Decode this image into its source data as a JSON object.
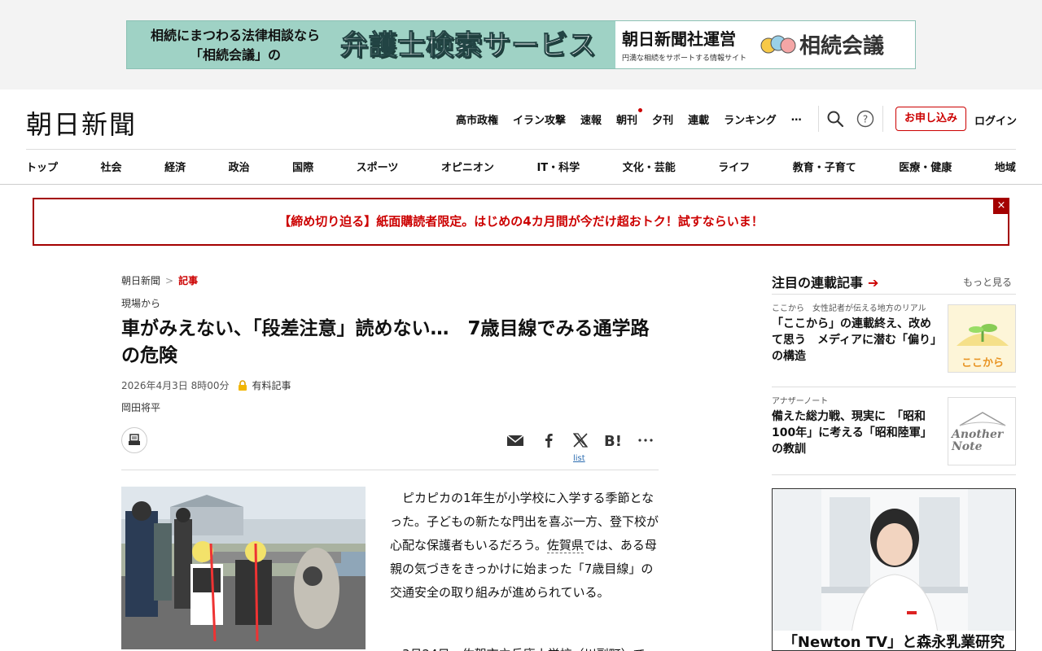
{
  "ad": {
    "left_line1": "相続にまつわる法律相談なら",
    "left_line2": "「相続会議」の",
    "big": "弁護士検索サービス",
    "operator": "朝日新聞社運営",
    "operator_sub": "円満な相続をサポートする情報サイト",
    "brand": "相続会議"
  },
  "header": {
    "logo": "朝日新聞",
    "topnav": [
      "高市政権",
      "イラン攻撃",
      "速報",
      "朝刊",
      "夕刊",
      "連載",
      "ランキング",
      "…"
    ],
    "subscribe": "お申し込み",
    "login": "ログイン"
  },
  "catnav": [
    "トップ",
    "社会",
    "経済",
    "政治",
    "国際",
    "スポーツ",
    "オピニオン",
    "IT・科学",
    "文化・芸能",
    "ライフ",
    "教育・子育て",
    "医療・健康",
    "地域"
  ],
  "promo": {
    "text": "【締め切り迫る】紙面購読者限定。はじめの4カ月間が今だけ超おトク！試すならいま！",
    "close": "×"
  },
  "article": {
    "breadcrumb": [
      "朝日新聞",
      "記事"
    ],
    "series": "現場から",
    "title": "車がみえない、「段差注意」読めない…　7歳目線でみる通学路の危険",
    "date": "2026年4月3日 8時00分",
    "paid": "有料記事",
    "author": "岡田将平",
    "list_link": "list",
    "body_pre": "ピカピカの1年生が小学校に入学する季節となった。子どもの新たな門出を喜ぶ一方、登下校が心配な保護者もいるだろう。",
    "body_link": "佐賀県",
    "body_post": "では、ある母親の気づきをきっかけに始まった「7歳目線」の交通安全の取り組みが進められている。",
    "body2": "3月24日、佐賀市立兵庫小学校（川副町）で"
  },
  "sidebar": {
    "heading": "注目の連載記事",
    "more": "もっと見る",
    "items": [
      {
        "kicker": "ここから　女性記者が伝える地方のリアル",
        "title": "「ここから」の連載終え、改めて思う　メディアに潜む「偏り」の構造",
        "thumb_label": "ここから"
      },
      {
        "kicker": "アナザーノート",
        "title": "備えた総力戦、現実に　「昭和100年」に考える「昭和陸軍」の教訓",
        "thumb_label": "Another Note"
      }
    ],
    "ad_caption": "「Newton TV」と森永乳業研究"
  },
  "colors": {
    "accent": "#cc0000",
    "promo_border": "#a40000",
    "ad_bg": "#9fd2c5"
  }
}
